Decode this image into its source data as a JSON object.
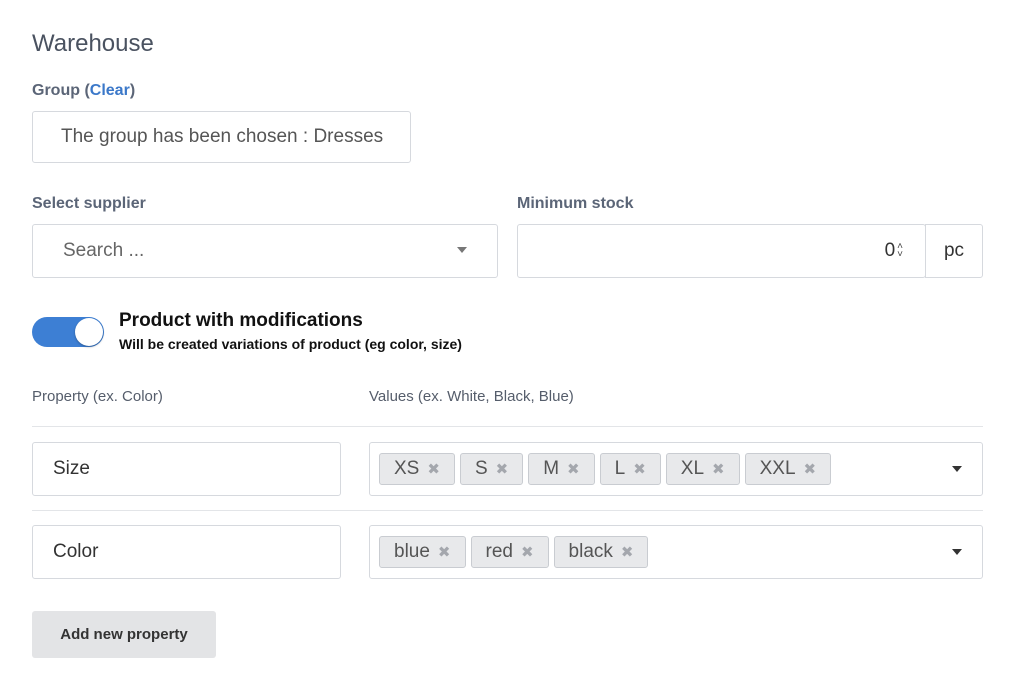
{
  "section": {
    "title": "Warehouse"
  },
  "group": {
    "label": "Group",
    "clear_label": "Clear",
    "value": "The group has been chosen : Dresses"
  },
  "supplier": {
    "label": "Select supplier",
    "placeholder": "Search ..."
  },
  "min_stock": {
    "label": "Minimum stock",
    "value": "0",
    "unit": "pc"
  },
  "modifications": {
    "enabled": true,
    "title": "Product with modifications",
    "subtitle": "Will be created variations of product (eg color, size)"
  },
  "properties_table": {
    "property_header": "Property (ex. Color)",
    "values_header": "Values (ex. White, Black, Blue)",
    "rows": [
      {
        "property": "Size",
        "values": [
          "XS",
          "S",
          "M",
          "L",
          "XL",
          "XXL"
        ]
      },
      {
        "property": "Color",
        "values": [
          "blue",
          "red",
          "black"
        ]
      }
    ]
  },
  "add_property_label": "Add new property",
  "colors": {
    "accent": "#3d7fd4",
    "link": "#3b78c9",
    "label": "#5b6577"
  },
  "icons": {
    "tag_remove": "x-mark-icon",
    "dropdown": "chevron-down-icon",
    "spinner": "spinner-arrows-icon"
  }
}
